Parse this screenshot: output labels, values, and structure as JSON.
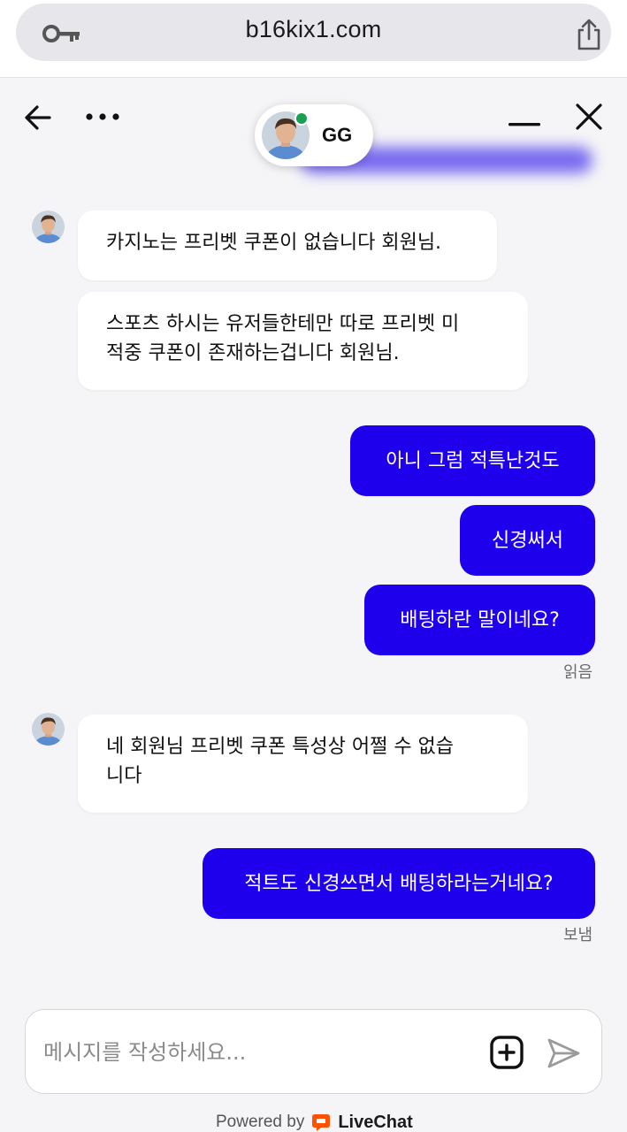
{
  "browser": {
    "url": "b16kix1.com",
    "key_icon": "key-icon",
    "share_icon": "share-icon"
  },
  "header": {
    "agent_name": "GG",
    "agent_status": "online",
    "back_icon": "arrow-left-icon",
    "more_icon": "more-horizontal-icon",
    "minimize_icon": "minimize-icon",
    "close_icon": "close-icon"
  },
  "messages": [
    {
      "sender": "agent",
      "text": "카지노는 프리벳 쿠폰이 없습니다 회원님."
    },
    {
      "sender": "agent",
      "line1": "스포츠 하시는 유저들한테만 따로 프리벳 미",
      "line2": "적중 쿠폰이 존재하는겁니다 회원님."
    },
    {
      "sender": "visitor",
      "text": "아니 그럼 적특난것도"
    },
    {
      "sender": "visitor",
      "text": "신경써서"
    },
    {
      "sender": "visitor",
      "text": "배팅하란 말이네요?",
      "status": "읽음"
    },
    {
      "sender": "agent",
      "line1": "네 회원님 프리벳 쿠폰 특성상 어쩔 수 없습",
      "line2": "니다"
    },
    {
      "sender": "visitor",
      "text": "적트도 신경쓰면서 배팅하라는거네요?",
      "status": "보냄"
    }
  ],
  "composer": {
    "placeholder": "메시지를 작성하세요...",
    "attach_icon": "plus-square-icon",
    "send_icon": "send-icon"
  },
  "footer": {
    "powered_by": "Powered by",
    "brand": "LiveChat"
  },
  "colors": {
    "visitor_bubble": "#1f00ec",
    "agent_bubble": "#ffffff",
    "background": "#f5f5f7",
    "online": "#1aa053",
    "livechat_orange": "#ff5100"
  }
}
